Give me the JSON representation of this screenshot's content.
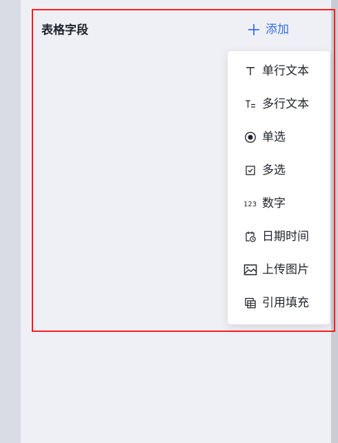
{
  "section": {
    "title": "表格字段"
  },
  "add_button": {
    "label": "添加",
    "color": "#3370e6"
  },
  "field_type_menu": {
    "items": [
      {
        "label": "单行文本",
        "icon": "text-icon"
      },
      {
        "label": "多行文本",
        "icon": "multiline-text-icon"
      },
      {
        "label": "单选",
        "icon": "radio-icon"
      },
      {
        "label": "多选",
        "icon": "checkbox-icon"
      },
      {
        "label": "数字",
        "icon": "number-icon",
        "icon_text": "123"
      },
      {
        "label": "日期时间",
        "icon": "calendar-clock-icon"
      },
      {
        "label": "上传图片",
        "icon": "image-icon"
      },
      {
        "label": "引用填充",
        "icon": "reference-icon"
      }
    ]
  },
  "colors": {
    "highlight_border": "#ff1a1a"
  }
}
